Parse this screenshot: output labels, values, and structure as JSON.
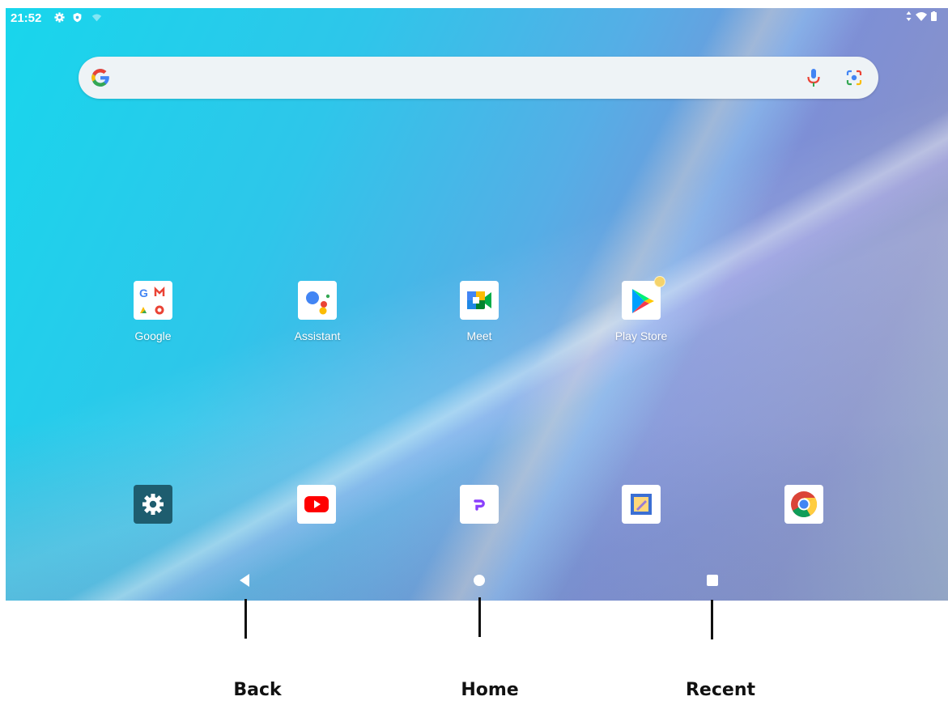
{
  "status_bar": {
    "time": "21:52",
    "left_icons": [
      "settings-icon",
      "shield-icon",
      "wifi-icon"
    ],
    "right_icons": [
      "data-arrows-icon",
      "wifi-signal-icon",
      "battery-icon"
    ]
  },
  "search_bar": {
    "logo": "google-g-icon",
    "mic_icon": "microphone-icon",
    "lens_icon": "camera-lens-icon"
  },
  "apps": [
    {
      "label": "Google",
      "icon": "google-folder-icon"
    },
    {
      "label": "Assistant",
      "icon": "assistant-icon"
    },
    {
      "label": "Meet",
      "icon": "meet-icon"
    },
    {
      "label": "Play Store",
      "icon": "play-store-icon",
      "has_notification_dot": true
    }
  ],
  "dock": [
    {
      "icon": "settings-app-icon"
    },
    {
      "icon": "youtube-icon"
    },
    {
      "icon": "p-app-icon"
    },
    {
      "icon": "notes-app-icon"
    },
    {
      "icon": "chrome-icon"
    }
  ],
  "nav_bar": {
    "back_icon": "back-triangle-icon",
    "home_icon": "home-circle-icon",
    "recent_icon": "recent-square-icon"
  },
  "annotations": {
    "back": "Back",
    "home": "Home",
    "recent": "Recent"
  },
  "colors": {
    "wallpaper_start": "#18d6ec",
    "wallpaper_end": "#a7b8c6",
    "search_bar_bg": "#eef3f6",
    "google_blue": "#4285F4",
    "google_red": "#EA4335",
    "google_yellow": "#FBBC05",
    "google_green": "#34A853"
  }
}
